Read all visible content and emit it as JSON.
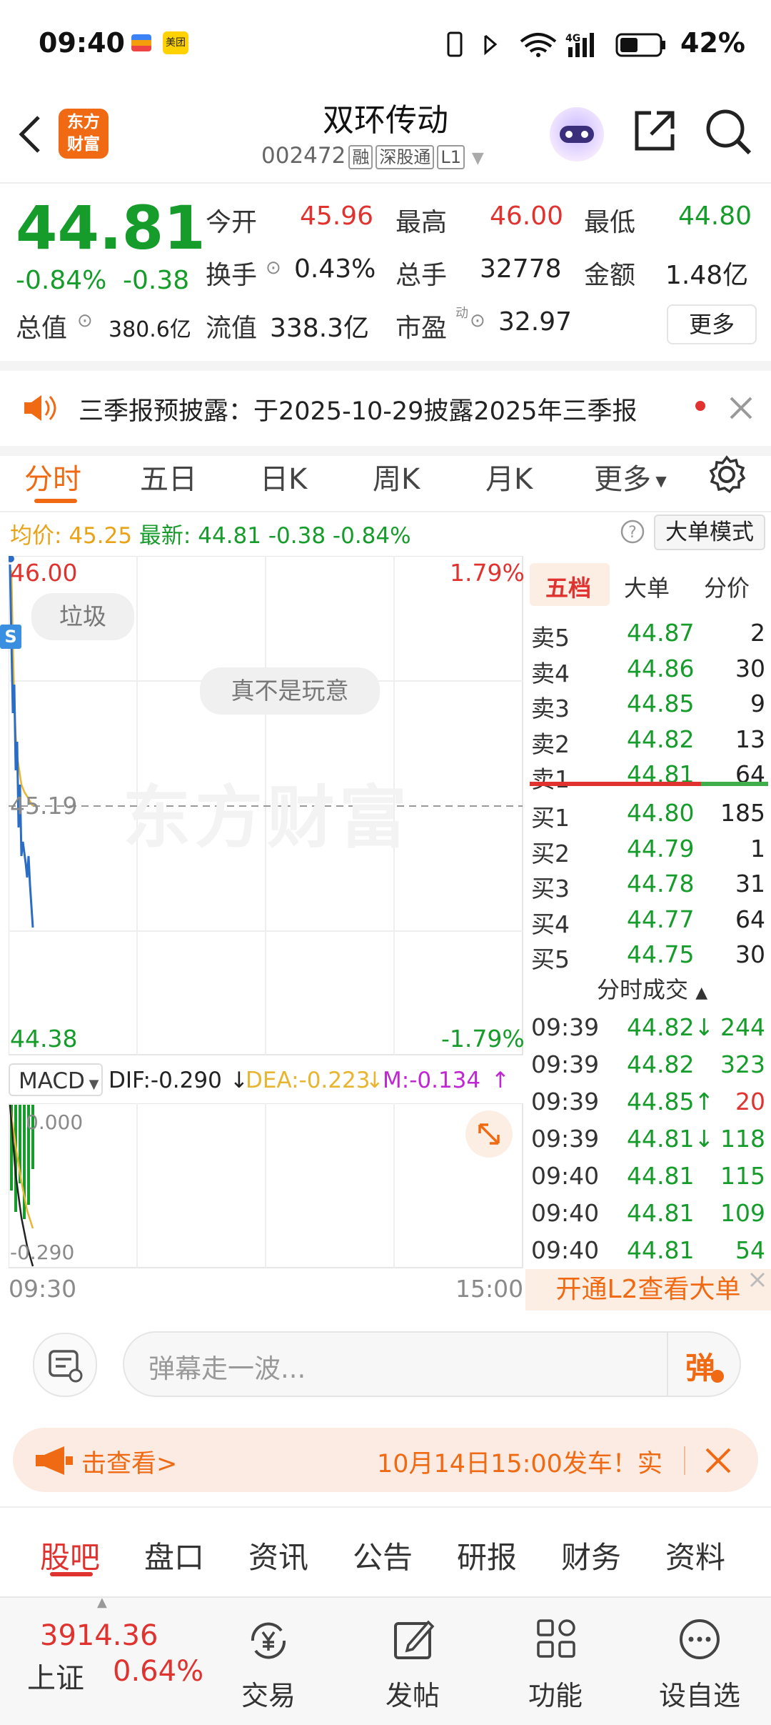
{
  "status": {
    "time": "09:40",
    "battery": "42%"
  },
  "header": {
    "title": "双环传动",
    "code": "002472",
    "tags": [
      "融",
      "深股通",
      "L1"
    ],
    "logo_line1": "东方",
    "logo_line2": "财富"
  },
  "quote": {
    "price": "44.81",
    "pct": "-0.84%",
    "chg": "-0.38",
    "open_label": "今开",
    "open": "45.96",
    "high_label": "最高",
    "high": "46.00",
    "low_label": "最低",
    "low": "44.80",
    "turnover_label": "换手",
    "turnover": "0.43%",
    "volume_label": "总手",
    "volume": "32778",
    "amount_label": "金额",
    "amount": "1.48亿",
    "mktcap_label": "总值",
    "mktcap": "380.6亿",
    "float_label": "流值",
    "float": "338.3亿",
    "pe_label": "市盈",
    "pe_sup": "动",
    "pe": "32.97",
    "more": "更多"
  },
  "notice": {
    "text": "三季报预披露：于2025-10-29披露2025年三季报"
  },
  "tabs": [
    "分时",
    "五日",
    "日K",
    "周K",
    "月K",
    "更多"
  ],
  "info": {
    "avg_label": "均价:",
    "avg": "45.25",
    "latest_label": "最新:",
    "latest": "44.81",
    "chg": "-0.38",
    "pct": "-0.84%",
    "mode": "大单模式"
  },
  "chart": {
    "top_price": "46.00",
    "top_pct": "1.79%",
    "mid_price": "45.19",
    "bottom_price": "44.38",
    "bottom_pct": "-1.79%",
    "bubble1": "垃圾",
    "bubble2": "真不是玩意",
    "watermark": "东方财富",
    "s_badge": "S",
    "time_start": "09:30",
    "time_end": "15:00"
  },
  "macd": {
    "selector": "MACD",
    "dif": "DIF:-0.290",
    "dea": "DEA:-0.223",
    "m": "M:-0.134",
    "top": "0.000",
    "bottom": "-0.290"
  },
  "panel": {
    "tabs": [
      "五档",
      "大单",
      "分价"
    ],
    "sells": [
      {
        "k": "卖5",
        "p": "44.87",
        "v": "2"
      },
      {
        "k": "卖4",
        "p": "44.86",
        "v": "30"
      },
      {
        "k": "卖3",
        "p": "44.85",
        "v": "9"
      },
      {
        "k": "卖2",
        "p": "44.82",
        "v": "13"
      },
      {
        "k": "卖1",
        "p": "44.81",
        "v": "64"
      }
    ],
    "buys": [
      {
        "k": "买1",
        "p": "44.80",
        "v": "185"
      },
      {
        "k": "买2",
        "p": "44.79",
        "v": "1"
      },
      {
        "k": "买3",
        "p": "44.78",
        "v": "31"
      },
      {
        "k": "买4",
        "p": "44.77",
        "v": "64"
      },
      {
        "k": "买5",
        "p": "44.75",
        "v": "30"
      }
    ],
    "trades_title": "分时成交",
    "trades": [
      {
        "t": "09:39",
        "p": "44.82↓",
        "v": "244"
      },
      {
        "t": "09:39",
        "p": "44.82",
        "v": "323"
      },
      {
        "t": "09:39",
        "p": "44.85↑",
        "v": "20"
      },
      {
        "t": "09:39",
        "p": "44.81↓",
        "v": "118"
      },
      {
        "t": "09:40",
        "p": "44.81",
        "v": "115"
      },
      {
        "t": "09:40",
        "p": "44.81",
        "v": "109"
      },
      {
        "t": "09:40",
        "p": "44.81",
        "v": "54"
      }
    ],
    "l2": "开通L2查看大单"
  },
  "comment": {
    "placeholder": "弹幕走一波...",
    "danmu_btn": "弹"
  },
  "promo": {
    "left": "击查看>",
    "right": "10月14日15:00发车！实"
  },
  "bottom_tabs": [
    "股吧",
    "盘口",
    "资讯",
    "公告",
    "研报",
    "财务",
    "资料"
  ],
  "nav": {
    "index_value": "3914.36",
    "index_name": "上证",
    "index_pct": "0.64%",
    "items": [
      "交易",
      "发帖",
      "功能",
      "设自选"
    ]
  }
}
